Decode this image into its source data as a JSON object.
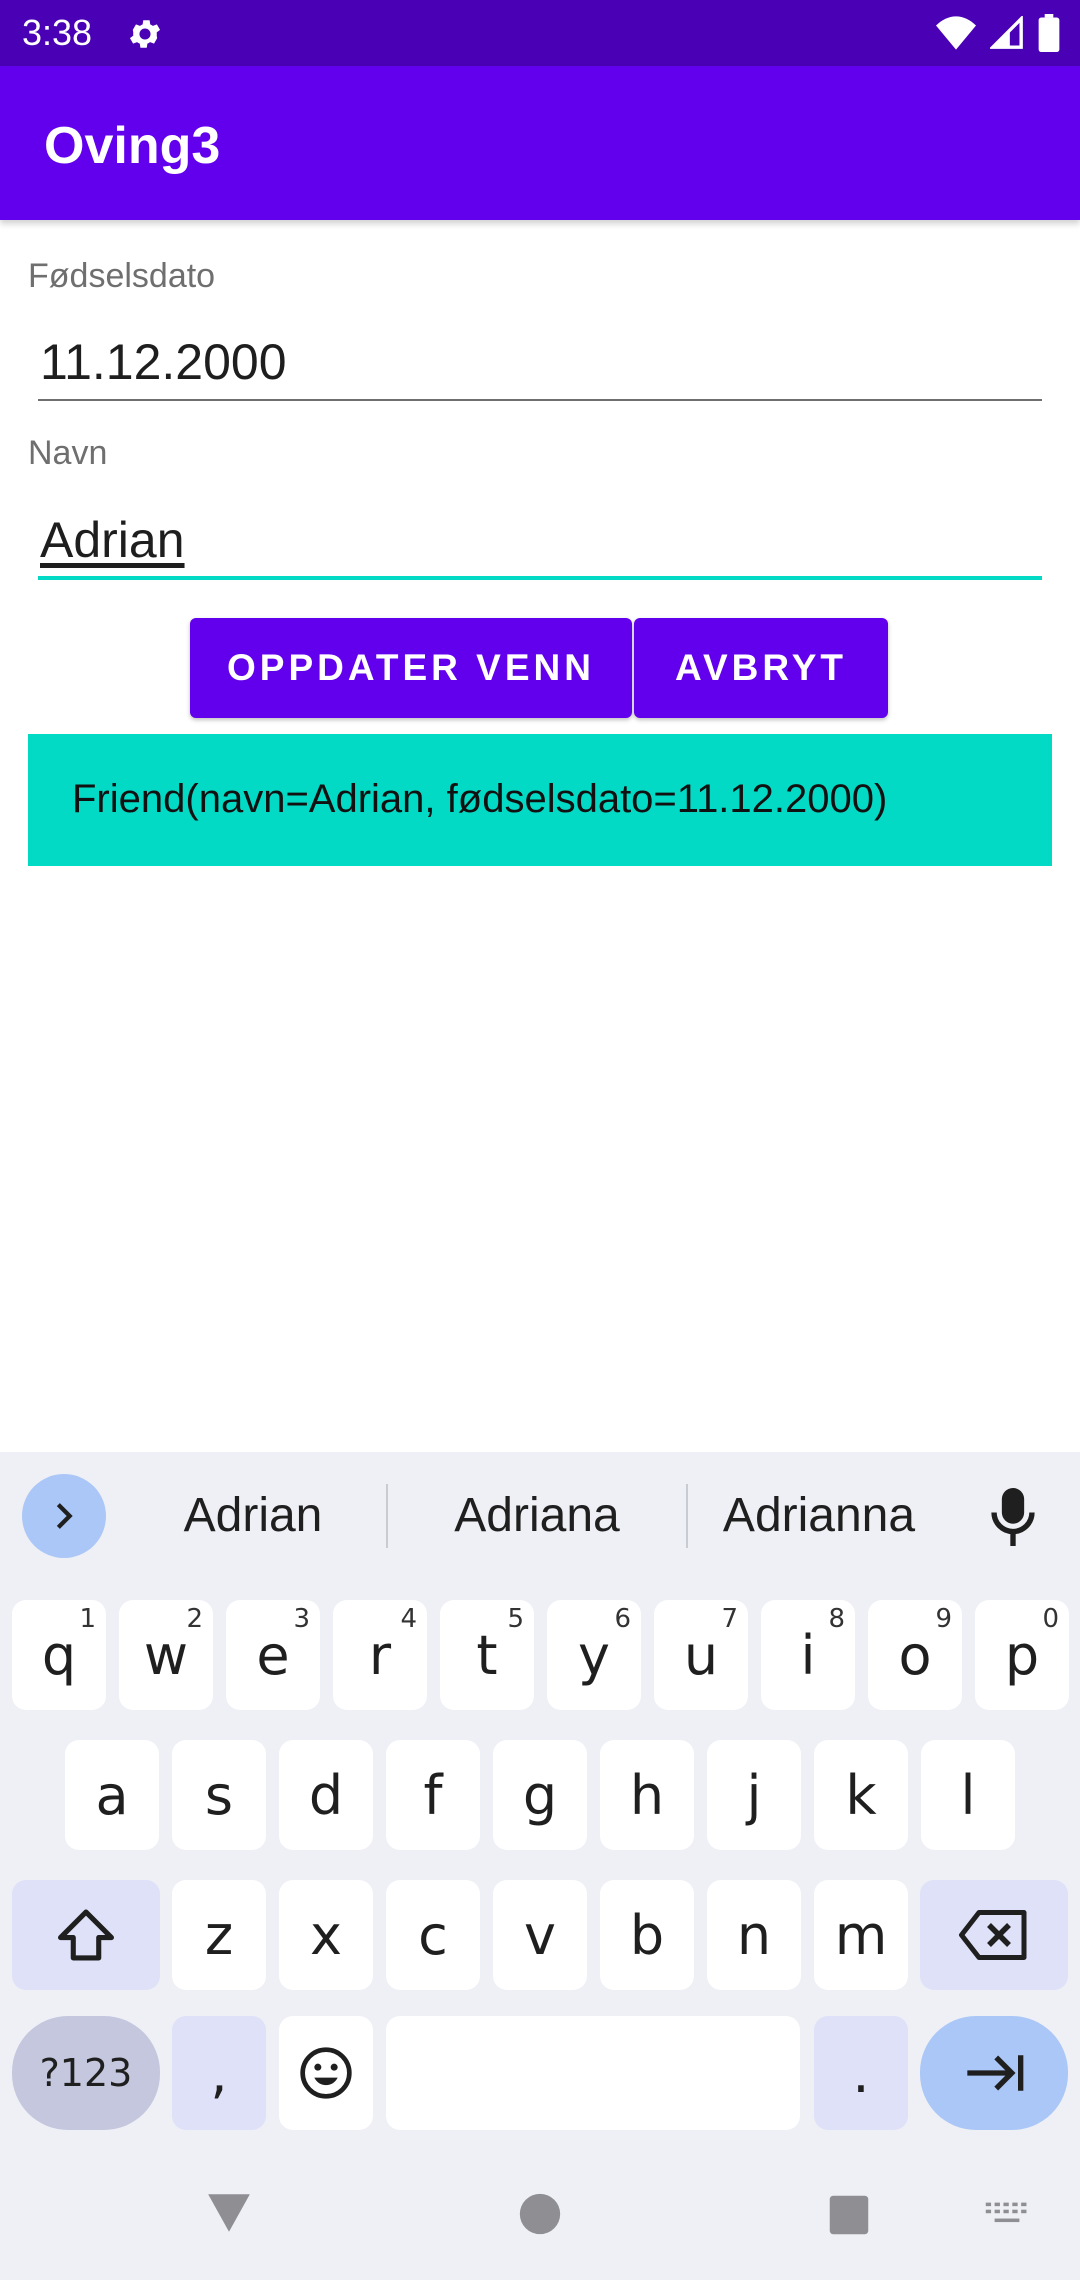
{
  "status_bar": {
    "time": "3:38",
    "icons": [
      "gear-icon",
      "wifi-icon",
      "signal-icon",
      "battery-icon"
    ]
  },
  "app_bar": {
    "title": "Oving3"
  },
  "form": {
    "birthdate": {
      "label": "Fødselsdato",
      "value": "11.12.2000"
    },
    "name": {
      "label": "Navn",
      "value": "Adrian"
    }
  },
  "buttons": {
    "update": "OPPDATER VENN",
    "cancel": "AVBRYT"
  },
  "result": {
    "text": "Friend(navn=Adrian, fødselsdato=11.12.2000)"
  },
  "keyboard": {
    "suggestions": [
      "Adrian",
      "Adriana",
      "Adrianna"
    ],
    "row1": [
      {
        "key": "q",
        "hint": "1"
      },
      {
        "key": "w",
        "hint": "2"
      },
      {
        "key": "e",
        "hint": "3"
      },
      {
        "key": "r",
        "hint": "4"
      },
      {
        "key": "t",
        "hint": "5"
      },
      {
        "key": "y",
        "hint": "6"
      },
      {
        "key": "u",
        "hint": "7"
      },
      {
        "key": "i",
        "hint": "8"
      },
      {
        "key": "o",
        "hint": "9"
      },
      {
        "key": "p",
        "hint": "0"
      }
    ],
    "row2": [
      "a",
      "s",
      "d",
      "f",
      "g",
      "h",
      "j",
      "k",
      "l"
    ],
    "row3": [
      "z",
      "x",
      "c",
      "v",
      "b",
      "n",
      "m"
    ],
    "bottom": {
      "symbols": "?123",
      "comma": ",",
      "period": "."
    }
  },
  "colors": {
    "status_bar": "#4a00b4",
    "primary": "#6200ee",
    "accent": "#03dac5",
    "field_active": "#03dac5"
  }
}
